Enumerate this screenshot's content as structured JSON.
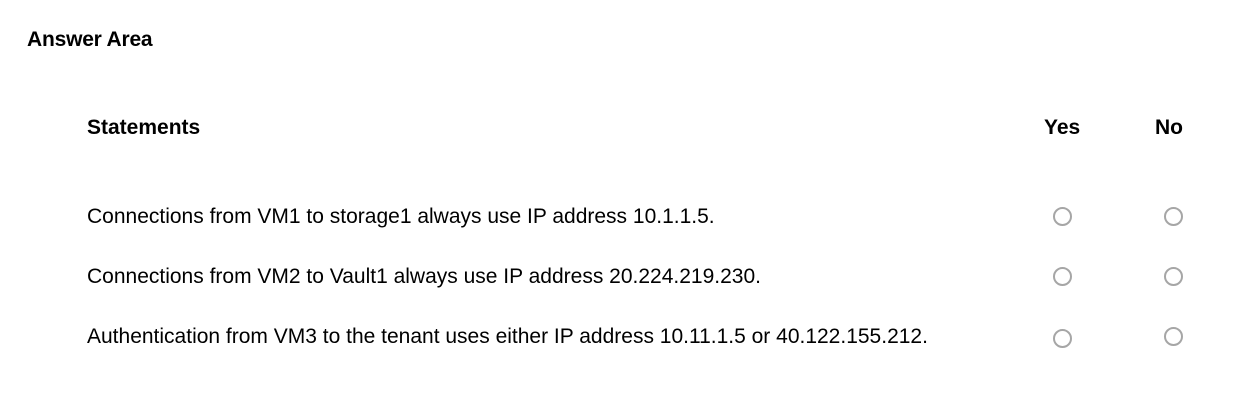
{
  "answer_area": {
    "title": "Answer Area"
  },
  "table": {
    "headers": {
      "statements": "Statements",
      "yes": "Yes",
      "no": "No"
    },
    "rows": [
      {
        "statement": "Connections from VM1 to storage1 always use IP address 10.1.1.5.",
        "yes_selected": false,
        "no_selected": false
      },
      {
        "statement": "Connections from VM2 to Vault1 always use IP address 20.224.219.230.",
        "yes_selected": false,
        "no_selected": false
      },
      {
        "statement": "Authentication from VM3 to the tenant uses either IP address 10.11.1.5 or 40.122.155.212.",
        "yes_selected": false,
        "no_selected": false
      }
    ]
  }
}
